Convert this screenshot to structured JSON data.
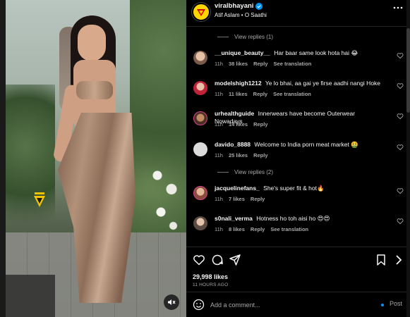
{
  "post": {
    "username": "viralbhayani",
    "audio": "Atif Aslam • O Saathi"
  },
  "comments": {
    "view_replies_1": "View replies (1)",
    "view_replies_2": "View replies (2)",
    "items": [
      {
        "username": "__unique_beauty__",
        "text": "Har baar same look hota hai 😂",
        "time": "11h",
        "likes": "38 likes",
        "reply": "Reply",
        "translate": "See translation"
      },
      {
        "username": "modelshigh1212",
        "text": "Ye lo bhai, aa gai ye firse aadhi nangi Hoke",
        "time": "11h",
        "likes": "11 likes",
        "reply": "Reply",
        "translate": "See translation"
      },
      {
        "username": "urhealthguide",
        "text": "Innerwears have become Outerwear Nowadays",
        "time": "11h",
        "likes": "14 likes",
        "reply": "Reply"
      },
      {
        "username": "davido_8888",
        "text": "Welcome to India porn meat market 🤮",
        "time": "11h",
        "likes": "25 likes",
        "reply": "Reply"
      },
      {
        "username": "jacquelinefans_",
        "text": "She's super fit & hot🔥",
        "time": "11h",
        "likes": "7 likes",
        "reply": "Reply"
      },
      {
        "username": "s0nali_verma",
        "text": "Hotness ho toh aisi ho 😍😍",
        "time": "11h",
        "likes": "8 likes",
        "reply": "Reply",
        "translate": "See translation"
      }
    ]
  },
  "footer": {
    "likes": "29,998 likes",
    "time": "11 HOURS AGO",
    "comment_placeholder": "Add a comment...",
    "post_label": "Post"
  },
  "colors": {
    "background": "#000000",
    "text": "#f5f5f5",
    "muted": "#a8a8a8",
    "accent": "#0095f6",
    "brand_yellow": "#ffd500"
  },
  "icons": [
    "heart-icon",
    "comment-icon",
    "share-icon",
    "bookmark-icon",
    "emoji-icon",
    "more-icon",
    "verified-icon",
    "mute-icon"
  ]
}
